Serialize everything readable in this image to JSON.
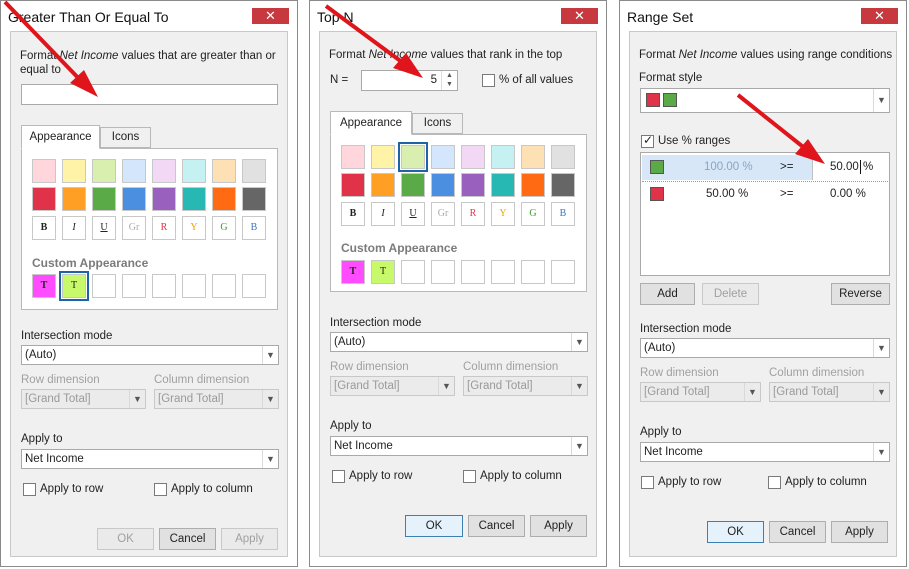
{
  "colors": {
    "red_arrow": "#e0141b",
    "swatches_light": [
      "#ffd6dc",
      "#fff3a8",
      "#d8efb0",
      "#d4e6fb",
      "#f2d8f4",
      "#c5f1f2",
      "#fde0b3",
      "#e1e1e1"
    ],
    "swatches_dark": [
      "#e0334a",
      "#ffa024",
      "#5aaa47",
      "#4a8fe0",
      "#9a60bd",
      "#27b8b3",
      "#ff6a13",
      "#666666"
    ],
    "custom_magenta": "#ff4cff",
    "custom_lime": "#c8f96a"
  },
  "dialog1": {
    "title": "Greater Than Or Equal To",
    "close": "✕",
    "format_pre": "Format ",
    "format_field": "Net Income",
    "format_post": " values that are greater than or equal to",
    "input_value": "",
    "tabs": [
      "Appearance",
      "Icons"
    ],
    "font_swatches": [
      "B",
      "I",
      "U",
      "Gr",
      "R",
      "Y",
      "G",
      "B"
    ],
    "custom_title": "Custom Appearance",
    "custom_items": [
      "T",
      "T"
    ],
    "intersection_label": "Intersection mode",
    "intersection_value": "(Auto)",
    "row_dim_label": "Row dimension",
    "col_dim_label": "Column dimension",
    "row_dim_value": "[Grand Total]",
    "col_dim_value": "[Grand Total]",
    "apply_to_label": "Apply to",
    "apply_to_value": "Net Income",
    "apply_row": "Apply to row",
    "apply_col": "Apply to column",
    "ok": "OK",
    "cancel": "Cancel",
    "apply": "Apply"
  },
  "dialog2": {
    "title": "Top N",
    "close": "✕",
    "format_pre": "Format ",
    "format_field": "Net Income",
    "format_post": " values that rank in the top",
    "n_label": "N =",
    "n_value": "5",
    "percent_label": "% of all values",
    "tabs": [
      "Appearance",
      "Icons"
    ],
    "font_swatches": [
      "B",
      "I",
      "U",
      "Gr",
      "R",
      "Y",
      "G",
      "B"
    ],
    "custom_title": "Custom Appearance",
    "custom_items": [
      "T",
      "T"
    ],
    "intersection_label": "Intersection mode",
    "intersection_value": "(Auto)",
    "row_dim_label": "Row dimension",
    "col_dim_label": "Column dimension",
    "row_dim_value": "[Grand Total]",
    "col_dim_value": "[Grand Total]",
    "apply_to_label": "Apply to",
    "apply_to_value": "Net Income",
    "apply_row": "Apply to row",
    "apply_col": "Apply to column",
    "ok": "OK",
    "cancel": "Cancel",
    "apply": "Apply"
  },
  "dialog3": {
    "title": "Range Set",
    "close": "✕",
    "format_pre": "Format ",
    "format_field": "Net Income",
    "format_post": " values using range conditions",
    "style_label": "Format style",
    "use_pct_label": "Use % ranges",
    "ranges": [
      {
        "from": "100.00 %",
        "op": ">=",
        "to": "50.00",
        "unit": "%"
      },
      {
        "from": "50.00 %",
        "op": ">=",
        "to": "0.00 %",
        "unit": ""
      }
    ],
    "add": "Add",
    "delete": "Delete",
    "reverse": "Reverse",
    "intersection_label": "Intersection mode",
    "intersection_value": "(Auto)",
    "row_dim_label": "Row dimension",
    "col_dim_label": "Column dimension",
    "row_dim_value": "[Grand Total]",
    "col_dim_value": "[Grand Total]",
    "apply_to_label": "Apply to",
    "apply_to_value": "Net Income",
    "apply_row": "Apply to row",
    "apply_col": "Apply to column",
    "ok": "OK",
    "cancel": "Cancel",
    "apply": "Apply"
  }
}
